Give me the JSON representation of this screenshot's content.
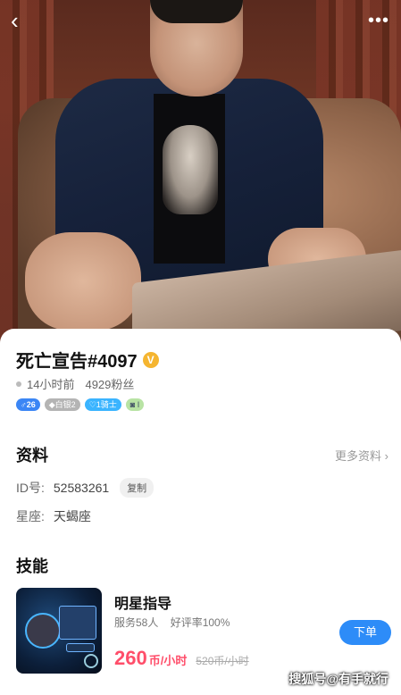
{
  "header": {
    "back_icon": "‹",
    "more_icon": "•••"
  },
  "profile": {
    "name": "死亡宣告#4097",
    "verified_badge": "V",
    "last_active": "14小时前",
    "fans": "4929粉丝",
    "tags": {
      "gender": "♂26",
      "silver": "◆白银2",
      "knight": "♡1骑士",
      "level": "◙ I"
    }
  },
  "info": {
    "title": "资料",
    "more_label": "更多资料 ›",
    "id_label": "ID号:",
    "id_value": "52583261",
    "copy_label": "复制",
    "star_label": "星座:",
    "star_value": "天蝎座"
  },
  "skills": {
    "title": "技能",
    "items": [
      {
        "name": "明星指导",
        "served": "服务58人",
        "rating": "好评率100%",
        "price": "260",
        "price_unit": "币/小时",
        "old_price": "520币/小时",
        "order_label": "下单"
      }
    ]
  },
  "watermark": "搜狐号@有手就行",
  "colors": {
    "accent": "#2d8cf8",
    "price": "#ff4e6a",
    "badge": "#f5b530"
  }
}
